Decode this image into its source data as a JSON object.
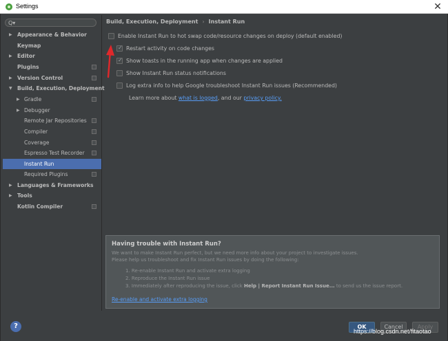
{
  "window": {
    "title": "Settings",
    "close_glyph": "✕"
  },
  "search": {
    "icon_glyph": "Q▾",
    "value": ""
  },
  "sidebar": {
    "items": [
      {
        "label": "Appearance & Behavior",
        "arrow": "▶"
      },
      {
        "label": "Keymap",
        "arrow": ""
      },
      {
        "label": "Editor",
        "arrow": "▶"
      },
      {
        "label": "Plugins",
        "arrow": ""
      },
      {
        "label": "Version Control",
        "arrow": "▶"
      },
      {
        "label": "Build, Execution, Deployment",
        "arrow": "▼"
      },
      {
        "label": "Gradle",
        "arrow": "▶"
      },
      {
        "label": "Debugger",
        "arrow": "▶"
      },
      {
        "label": "Remote Jar Repositories",
        "arrow": ""
      },
      {
        "label": "Compiler",
        "arrow": ""
      },
      {
        "label": "Coverage",
        "arrow": ""
      },
      {
        "label": "Espresso Test Recorder",
        "arrow": ""
      },
      {
        "label": "Instant Run",
        "arrow": ""
      },
      {
        "label": "Required Plugins",
        "arrow": ""
      },
      {
        "label": "Languages & Frameworks",
        "arrow": "▶"
      },
      {
        "label": "Tools",
        "arrow": "▶"
      },
      {
        "label": "Kotlin Compiler",
        "arrow": ""
      }
    ]
  },
  "breadcrumb": {
    "section": "Build, Execution, Deployment",
    "separator": "›",
    "page": "Instant Run"
  },
  "options": {
    "enable": {
      "label": "Enable Instant Run to hot swap code/resource changes on deploy (default enabled)",
      "checked": false
    },
    "restart": {
      "label": "Restart activity on code changes",
      "checked": true
    },
    "toasts": {
      "label": "Show toasts in the running app when changes are applied",
      "checked": true
    },
    "status": {
      "label": "Show Instant Run status notifications",
      "checked": false
    },
    "log": {
      "label": "Log extra info to help Google troubleshoot Instant Run issues (Recommended)",
      "checked": false
    }
  },
  "learn_more": {
    "prefix": "Learn more about ",
    "link1": "what is logged",
    "middle": ", and our ",
    "link2": "privacy policy."
  },
  "help_panel": {
    "title": "Having trouble with Instant Run?",
    "line1": "We want to make Instant Run perfect, but we need more info about your project to investigate issues.",
    "line2": "Please help us troubleshoot and fix Instant Run issues by doing the following:",
    "step1": "1. Re-enable Instant Run and activate extra logging",
    "step2": "2. Reproduce the Instant Run issue",
    "step3_prefix": "3. Immediately after reproducing the issue, click ",
    "step3_bold": "Help | Report Instant Run Issue...",
    "step3_suffix": " to send us the issue report.",
    "link": "Re-enable and activate extra logging"
  },
  "footer": {
    "help_glyph": "?",
    "ok": "OK",
    "cancel": "Cancel",
    "apply": "Apply",
    "watermark": "https://blog.csdn.net/fitaotao"
  },
  "colors": {
    "background": "#3c3f41",
    "selection": "#4b6eaf",
    "link": "#589df6",
    "arrow": "#e0282b"
  }
}
